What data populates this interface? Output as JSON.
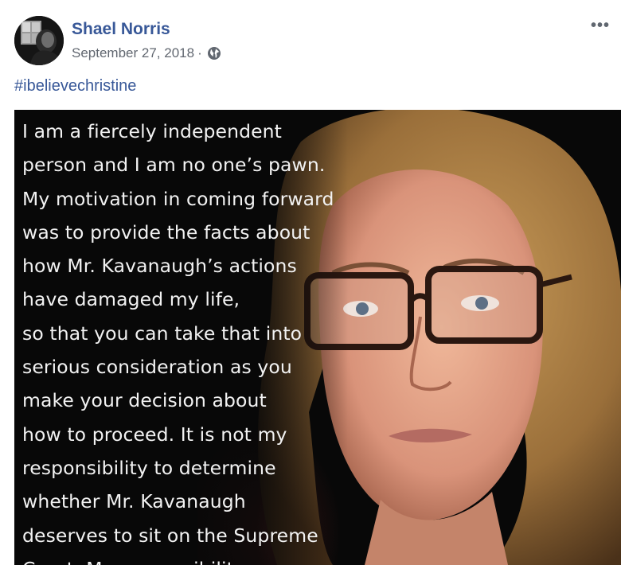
{
  "post": {
    "author": "Shael Norris",
    "date": "September 27, 2018",
    "separator": "·",
    "privacy_icon": "globe-icon",
    "more_icon": "more-options-icon",
    "more_label": "•••",
    "hashtag": "#ibelievechristine"
  },
  "photo": {
    "quote_lines": [
      "I am a fiercely independent",
      "person and I am no one’s pawn.",
      "My motivation in coming forward",
      "was to provide the facts about",
      "how Mr. Kavanaugh’s actions",
      "have damaged my life,",
      "so that you can take that into",
      "serious consideration as you",
      "make your decision about",
      "how to proceed. It is not my",
      "responsibility to determine",
      "whether Mr. Kavanaugh",
      "deserves to sit on the Supreme",
      "Court. My responsibility"
    ]
  },
  "colors": {
    "link_blue": "#385898",
    "meta_gray": "#616770",
    "photo_background": "#080808"
  }
}
